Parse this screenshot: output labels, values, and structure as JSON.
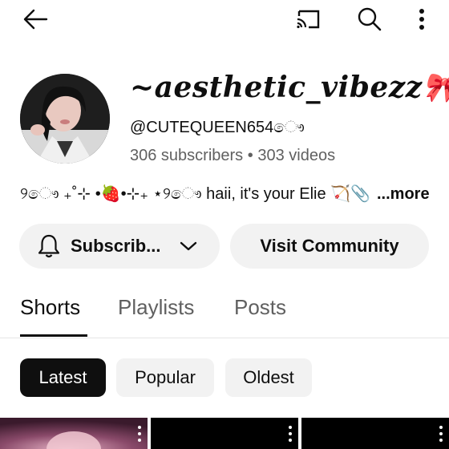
{
  "header": {
    "icons": [
      "back-arrow-icon",
      "cast-icon",
      "search-icon",
      "more-vert-icon"
    ]
  },
  "channel": {
    "name": "~aesthetic_vibezz🎀",
    "handle": "@CUTEQUEEN654ෞ",
    "subscribers": "306 subscribers",
    "separator": "•",
    "videos": "303 videos",
    "bio": "୨ෞ ₊˚⊹ •🍓•⊹₊ ⋆୨ෞ haii, it's your Elie 🏹📎",
    "bio_more": "...more"
  },
  "actions": {
    "subscribe_label": "Subscrib...",
    "visit_label": "Visit Community"
  },
  "tabs": [
    {
      "label": "Shorts",
      "active": true
    },
    {
      "label": "Playlists",
      "active": false
    },
    {
      "label": "Posts",
      "active": false
    }
  ],
  "filters": [
    {
      "label": "Latest",
      "selected": true
    },
    {
      "label": "Popular",
      "selected": false
    },
    {
      "label": "Oldest",
      "selected": false
    }
  ],
  "colors": {
    "text": "#0f0f0f",
    "secondary_text": "#606060",
    "pill_bg": "#f2f2f2",
    "chip_selected_bg": "#0f0f0f",
    "background": "#ffffff"
  }
}
